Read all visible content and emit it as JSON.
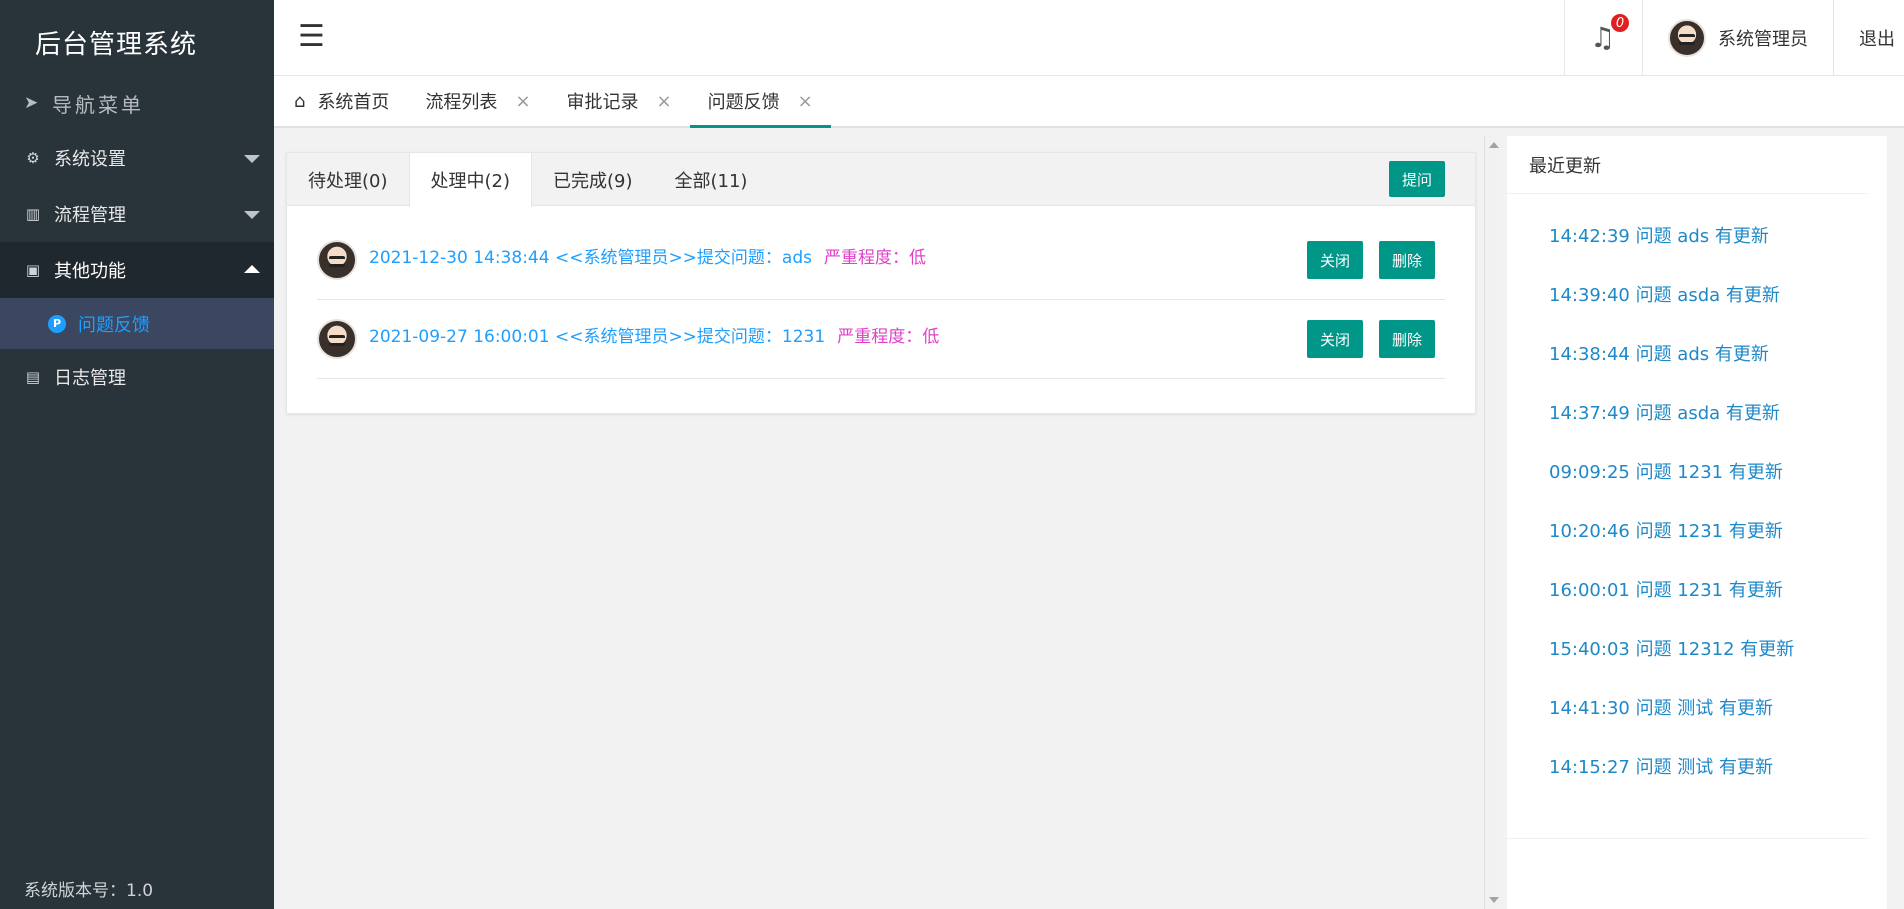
{
  "app": {
    "title": "后台管理系统",
    "version_text": "系统版本号：1.0"
  },
  "sidebar": {
    "nav_header": "导航菜单",
    "items": [
      {
        "label": "系统设置"
      },
      {
        "label": "流程管理"
      },
      {
        "label": "其他功能"
      },
      {
        "label": "日志管理"
      }
    ],
    "submenu": {
      "icon_letter": "P",
      "label": "问题反馈"
    }
  },
  "header": {
    "menu_toggle": "☰",
    "notification_count": "0",
    "username": "系统管理员",
    "logout_label": "退出"
  },
  "page_tabs": [
    {
      "label": "系统首页"
    },
    {
      "label": "流程列表",
      "close": "×"
    },
    {
      "label": "审批记录",
      "close": "×"
    },
    {
      "label": "问题反馈",
      "close": "×"
    }
  ],
  "status_tabs": [
    {
      "label": "待处理(0)"
    },
    {
      "label": "处理中(2)"
    },
    {
      "label": "已完成(9)"
    },
    {
      "label": "全部(11)"
    }
  ],
  "ask_button": "提问",
  "issues": [
    {
      "text": "2021-12-30 14:38:44 <<系统管理员>>提交问题：ads",
      "severity": "严重程度：低",
      "close_label": "关闭",
      "delete_label": "删除"
    },
    {
      "text": "2021-09-27 16:00:01 <<系统管理员>>提交问题：1231",
      "severity": "严重程度：低",
      "close_label": "关闭",
      "delete_label": "删除"
    }
  ],
  "recent": {
    "title": "最近更新",
    "items": [
      "14:42:39 问题 ads 有更新",
      "14:39:40 问题 asda 有更新",
      "14:38:44 问题 ads 有更新",
      "14:37:49 问题 asda 有更新",
      "09:09:25 问题 1231 有更新",
      "10:20:46 问题 1231 有更新",
      "16:00:01 问题 1231 有更新",
      "15:40:03 问题 12312 有更新",
      "14:41:30 问题 测试 有更新",
      "14:15:27 问题 测试 有更新"
    ]
  },
  "colors": {
    "sidebar_bg": "#28333a",
    "accent_green": "#009688",
    "link_blue": "#1e9fff",
    "severity_pink": "#e040c8",
    "badge_red": "#e02020"
  }
}
